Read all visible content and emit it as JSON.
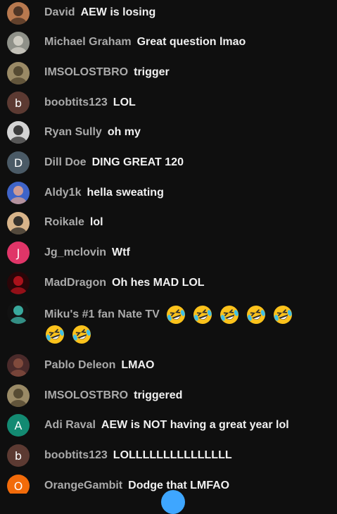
{
  "messages": [
    {
      "author": "David",
      "text": "AEW is losing",
      "avatar": {
        "kind": "photo",
        "bg": "#b8794f",
        "fg": "#3d2a1e"
      }
    },
    {
      "author": "Michael Graham",
      "text": "Great question lmao",
      "avatar": {
        "kind": "photo",
        "bg": "#8f9189",
        "fg": "#d9d6cc"
      }
    },
    {
      "author": "IMSOLOSTBRO",
      "text": "trigger",
      "avatar": {
        "kind": "photo",
        "bg": "#9a8a66",
        "fg": "#4a3f2a"
      }
    },
    {
      "author": "boobtits123",
      "text": "LOL",
      "avatar": {
        "kind": "letter",
        "letter": "b",
        "bg": "#5c3a32"
      }
    },
    {
      "author": "Ryan Sully",
      "text": "oh my",
      "avatar": {
        "kind": "photo",
        "bg": "#d4d4d4",
        "fg": "#222222"
      }
    },
    {
      "author": "Dill Doe",
      "text": "DING GREAT 120",
      "avatar": {
        "kind": "letter",
        "letter": "D",
        "bg": "#4a5a66"
      }
    },
    {
      "author": "Aldy1k",
      "text": "hella sweating",
      "avatar": {
        "kind": "photo",
        "bg": "#3f64c8",
        "fg": "#e7a58c"
      }
    },
    {
      "author": "Roikale",
      "text": "lol",
      "avatar": {
        "kind": "photo",
        "bg": "#d8b48a",
        "fg": "#1b1b1b"
      }
    },
    {
      "author": "Jg_mclovin",
      "text": "Wtf",
      "avatar": {
        "kind": "letter",
        "letter": "J",
        "bg": "#e03568"
      }
    },
    {
      "author": "MadDragon",
      "text": "Oh hes MAD LOL",
      "avatar": {
        "kind": "photo",
        "bg": "#2a0508",
        "fg": "#c0151f"
      }
    },
    {
      "author": "Miku's #1 fan Nate TV",
      "text": "",
      "emoji_count": 7,
      "avatar": {
        "kind": "photo",
        "bg": "#121212",
        "fg": "#41c3b5"
      }
    },
    {
      "author": "Pablo Deleon",
      "text": "LMAO",
      "avatar": {
        "kind": "photo",
        "bg": "#4a2a2a",
        "fg": "#8a5040"
      }
    },
    {
      "author": "IMSOLOSTBRO",
      "text": "triggered",
      "avatar": {
        "kind": "photo",
        "bg": "#9a8a66",
        "fg": "#4a3f2a"
      }
    },
    {
      "author": "Adi Raval",
      "text": "AEW is NOT having a great year lol",
      "avatar": {
        "kind": "letter",
        "letter": "A",
        "bg": "#138a72"
      }
    },
    {
      "author": "boobtits123",
      "text": "LOLLLLLLLLLLLLLLL",
      "avatar": {
        "kind": "letter",
        "letter": "b",
        "bg": "#5c3a32"
      }
    },
    {
      "author": "OrangeGambit",
      "text": "Dodge that LMFAO",
      "avatar": {
        "kind": "letter",
        "letter": "O",
        "bg": "#f26b0a"
      }
    }
  ],
  "emoji_name": "rolling-on-floor-laughing-emoji",
  "colors": {
    "background": "#0f0f0f",
    "author": "#aaaaaa",
    "message": "#f1f1f1",
    "accent": "#3ea6ff"
  }
}
